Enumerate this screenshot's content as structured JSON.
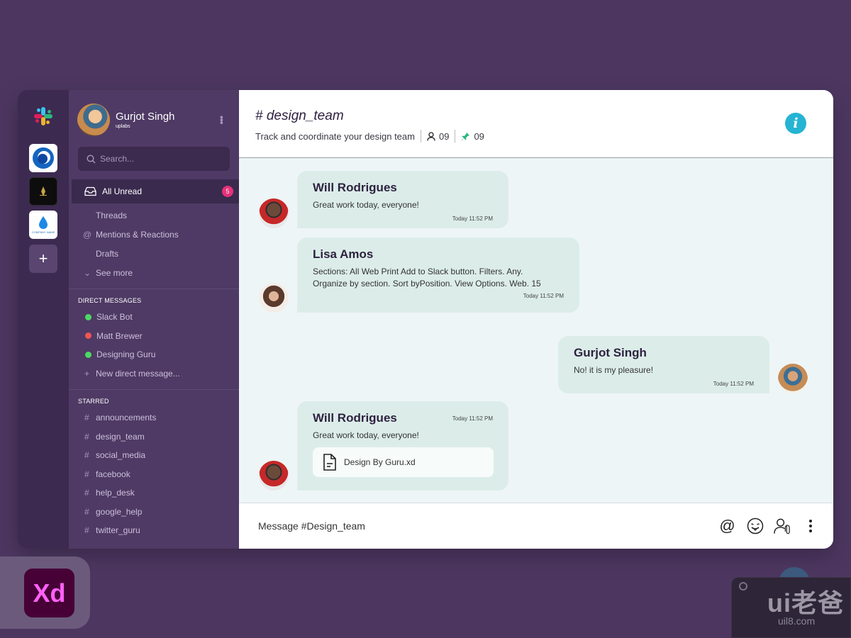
{
  "user": {
    "name": "Gurjot Singh",
    "subtitle": "uplabs"
  },
  "search": {
    "placeholder": "Search..."
  },
  "workspaces": {
    "add_label": "+",
    "ws3_label": "COMPANY NAME"
  },
  "nav": {
    "all_unread": {
      "label": "All Unread",
      "badge": "5"
    },
    "items": [
      {
        "label": "Threads",
        "icon": "none"
      },
      {
        "label": "Mentions & Reactions",
        "icon": "at-icon"
      },
      {
        "label": "Drafts",
        "icon": "none"
      },
      {
        "label": "See more",
        "icon": "chevron-down-icon"
      }
    ]
  },
  "direct_messages": {
    "title": "DIRECT MESSAGES",
    "items": [
      {
        "label": "Slack Bot",
        "status_color": "#4cd964"
      },
      {
        "label": "Matt Brewer",
        "status_color": "#f05454"
      },
      {
        "label": "Designing Guru",
        "status_color": "#4cd964"
      }
    ],
    "new_label": "New direct message..."
  },
  "starred": {
    "title": "STARRED",
    "channels": [
      "announcements",
      "design_team",
      "social_media",
      "facebook",
      "help_desk",
      "google_help",
      "twitter_guru"
    ]
  },
  "channel": {
    "title": "# design_team",
    "description": "Track and coordinate your design team",
    "members": "09",
    "pins": "09"
  },
  "messages": [
    {
      "author": "Will Rodrigues",
      "text": "Great work today, everyone!",
      "time": "Today  11:52 PM"
    },
    {
      "author": "Lisa Amos",
      "text_lines": [
        "Sections: All Web Print Add to Slack button. Filters. Any.",
        "Organize by section. Sort byPosition. View Options. Web. 15"
      ],
      "time": "Today  11:52 PM"
    },
    {
      "author": "Gurjot Singh",
      "text": "No! it is my pleasure!",
      "time": "Today  11:52 PM"
    },
    {
      "author": "Will Rodrigues",
      "text": "Great work today, everyone!",
      "time": "Today  11:52 PM",
      "file": "Design By Guru.xd"
    }
  ],
  "composer": {
    "placeholder": "Message #Design_team"
  },
  "brand": {
    "xd_label": "Xd",
    "watermark_main": "ui老爸",
    "watermark_sub": "uil8.com"
  },
  "colors": {
    "accent_info": "#25b4d3",
    "badge": "#e5317a",
    "bubble": "#dcede9"
  }
}
